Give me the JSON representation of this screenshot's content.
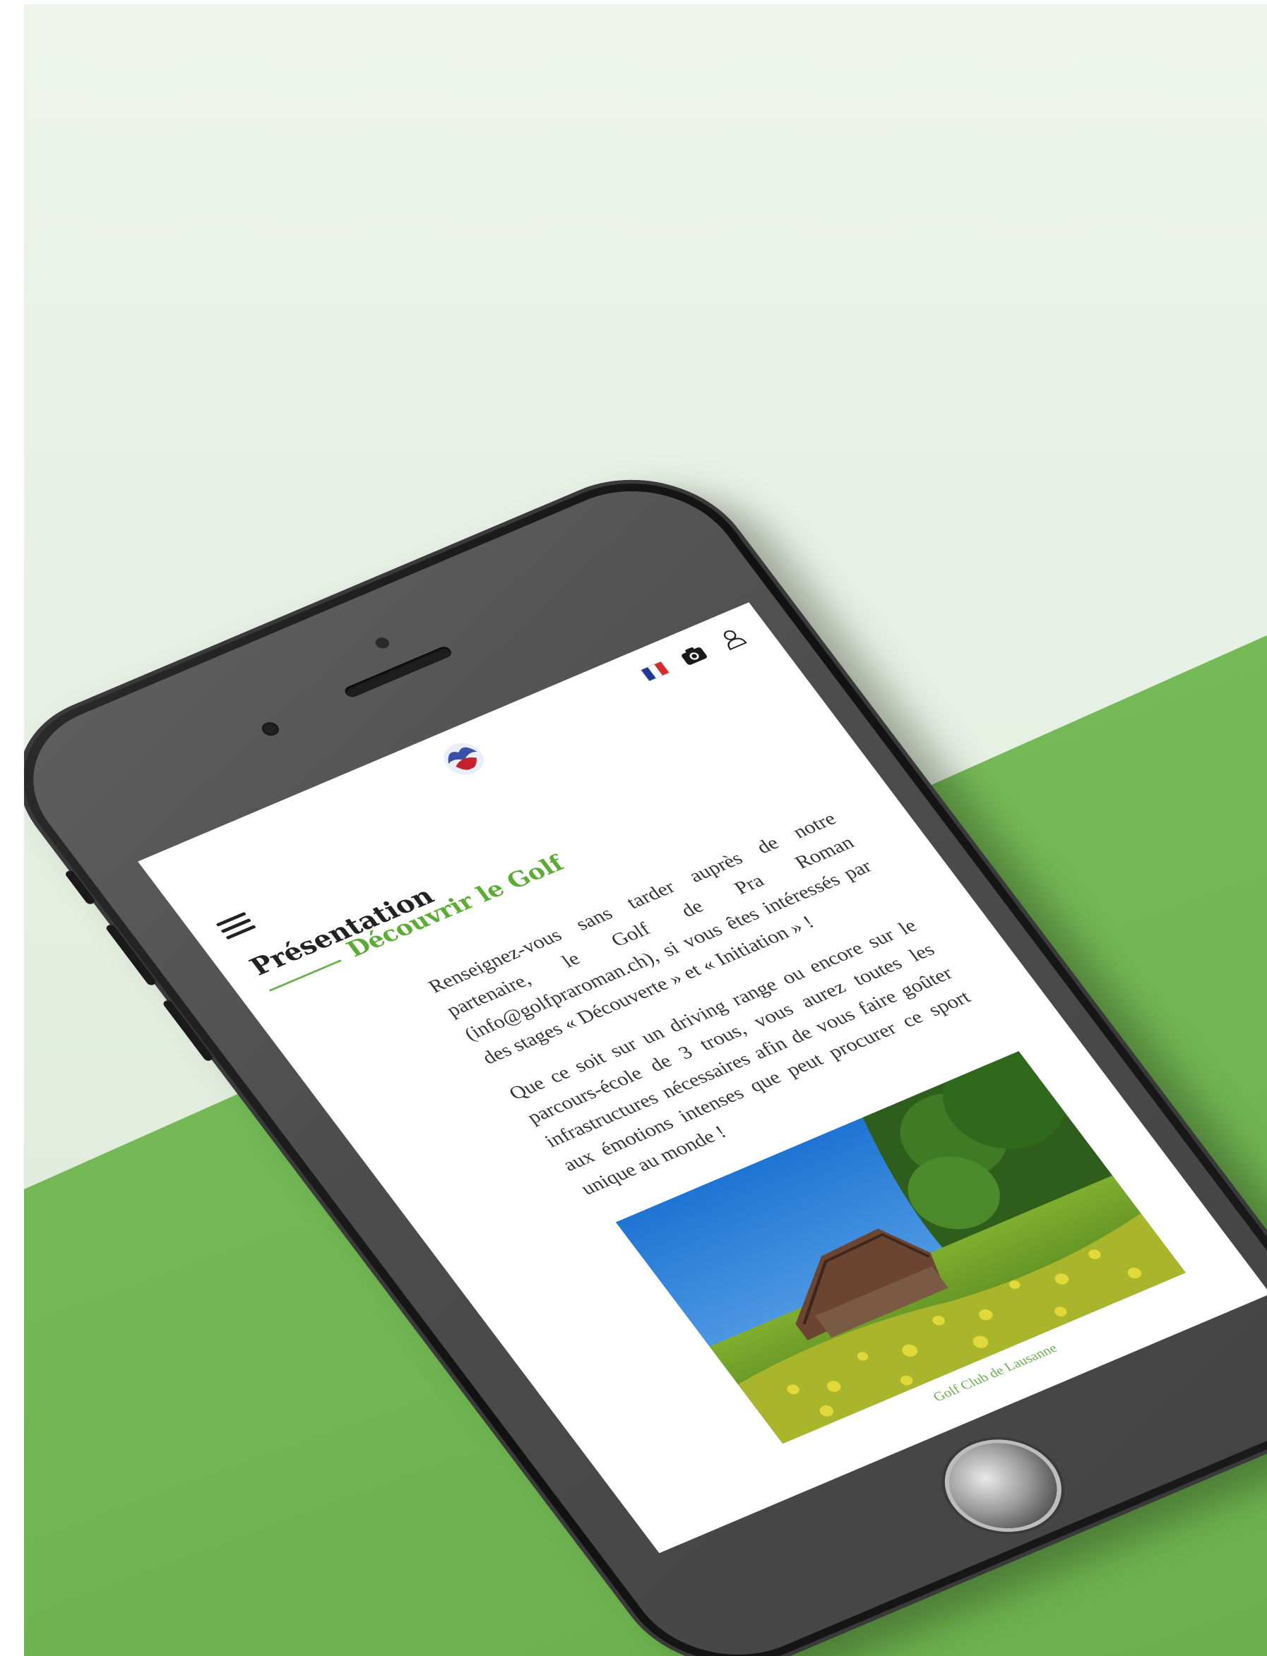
{
  "header": {
    "logo_name": "golf-club-logo",
    "language_flag": "fr-flag",
    "camera_icon": "camera-icon",
    "user_icon": "user-icon",
    "menu_icon": "hamburger-menu-icon"
  },
  "page": {
    "title": "Présentation",
    "subtitle": "Découvrir le Golf",
    "paragraphs": [
      "Renseignez-vous sans tarder auprès de notre partenaire, le Golf de Pra Roman (info@golfpraroman.ch), si vous êtes intéressés par des stages « Découverte » et « Initiation » !",
      "Que ce soit sur un driving range ou encore sur le parcours-école de 3 trous, vous aurez toutes les infrastructures nécessaires afin de vous faire goûter aux émotions intenses que peut procurer ce sport unique au monde !"
    ],
    "image_caption": "Golf Club de Lausanne"
  },
  "colors": {
    "accent_green": "#5bac35",
    "background_green": "#74b956",
    "background_pale": "#e3eee0",
    "phone_body": "#1b1b1b"
  }
}
